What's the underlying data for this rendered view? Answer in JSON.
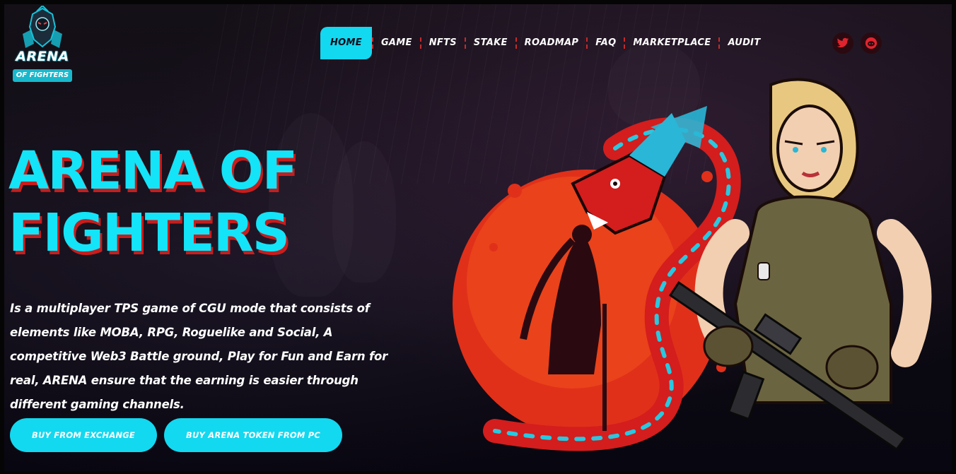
{
  "logo": {
    "line1": "ARENA",
    "line2": "OF FIGHTERS"
  },
  "nav": {
    "items": [
      {
        "label": "HOME",
        "active": true
      },
      {
        "label": "GAME",
        "active": false
      },
      {
        "label": "NFTS",
        "active": false
      },
      {
        "label": "STAKE",
        "active": false
      },
      {
        "label": "ROADMAP",
        "active": false
      },
      {
        "label": "FAQ",
        "active": false
      },
      {
        "label": "MARKETPLACE",
        "active": false
      },
      {
        "label": "AUDIT",
        "active": false
      }
    ],
    "social": [
      {
        "icon": "twitter-icon",
        "color": "#e0242e"
      },
      {
        "icon": "discord-icon",
        "color": "#e0242e"
      }
    ]
  },
  "hero": {
    "title_line1": "ARENA OF",
    "title_line2": "FIGHTERS",
    "description": "Is a multiplayer TPS game of CGU mode that consists of elements like MOBA, RPG, Roguelike and Social, A competitive Web3 Battle ground, Play for Fun and Earn for real, ARENA ensure that the earning is easier through different gaming channels.",
    "buttons": {
      "exchange": "BUY FROM EXCHANGE",
      "pc": "BUY ARENA TOKEN FROM PC"
    }
  },
  "colors": {
    "accent": "#12d8f0",
    "title_shadow": "#c81d1d",
    "nav_separator": "#c62a2a",
    "background": "#0a0810"
  }
}
